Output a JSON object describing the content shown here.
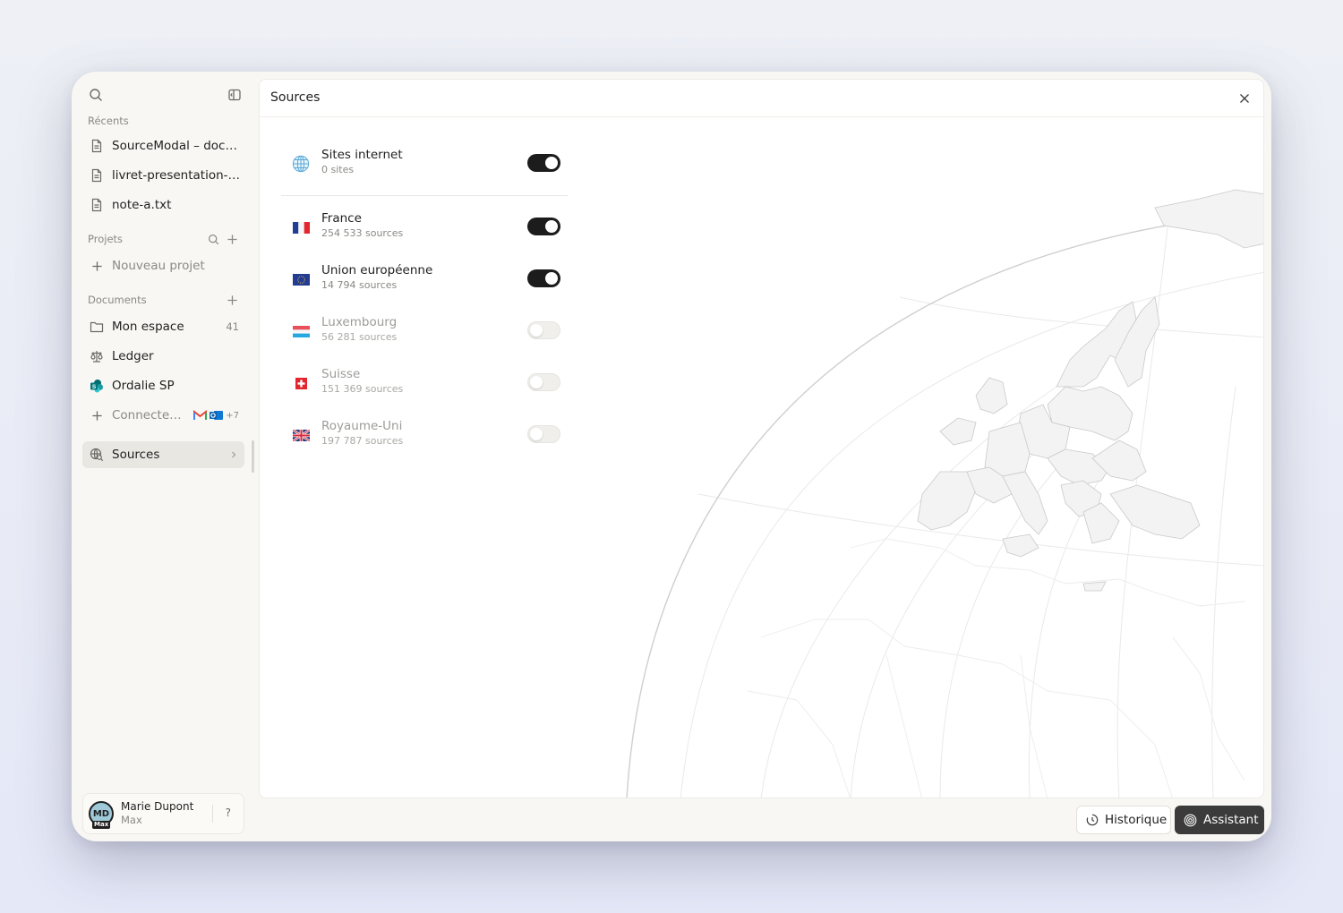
{
  "sidebar": {
    "recents_label": "Récents",
    "recents": [
      {
        "label": "SourceModal – doc…"
      },
      {
        "label": "livret-presentation-…"
      },
      {
        "label": "note-a.txt"
      }
    ],
    "projects_label": "Projets",
    "new_project_label": "Nouveau projet",
    "documents_label": "Documents",
    "documents": [
      {
        "label": "Mon espace",
        "count": "41"
      },
      {
        "label": "Ledger"
      },
      {
        "label": "Ordalie SP"
      }
    ],
    "connect_label": "Connecter …",
    "connect_more": "+7",
    "sources_label": "Sources",
    "user": {
      "initials": "MD",
      "tag": "Max",
      "name": "Marie Dupont",
      "plan": "Max",
      "help": "?"
    }
  },
  "panel": {
    "title": "Sources",
    "sources": [
      {
        "name": "Sites internet",
        "sub": "0 sites",
        "enabled": true,
        "icon": "globe-icon"
      },
      {
        "name": "France",
        "sub": "254 533 sources",
        "enabled": true,
        "icon": "flag-france"
      },
      {
        "name": "Union européenne",
        "sub": "14 794 sources",
        "enabled": true,
        "icon": "flag-eu"
      },
      {
        "name": "Luxembourg",
        "sub": "56 281 sources",
        "enabled": false,
        "icon": "flag-luxembourg"
      },
      {
        "name": "Suisse",
        "sub": "151 369 sources",
        "enabled": false,
        "icon": "flag-switzerland"
      },
      {
        "name": "Royaume-Uni",
        "sub": "197 787 sources",
        "enabled": false,
        "icon": "flag-uk"
      }
    ]
  },
  "footer": {
    "history_label": "Historique",
    "assistant_label": "Assistant"
  },
  "colors": {
    "window_bg": "#f8f7f4",
    "toggle_on": "#1c1c1c",
    "assistant_bg": "#3b3b3b",
    "active_item_bg": "#e9e7e2"
  }
}
